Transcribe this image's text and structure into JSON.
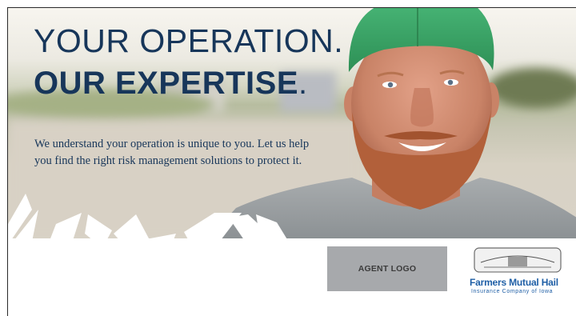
{
  "headline": {
    "line1": "YOUR OPERATION.",
    "line2": "OUR EXPERTISE",
    "line2_period": "."
  },
  "body_copy": "We understand your operation is unique to you. Let us help you find the right risk management solutions to protect it.",
  "agent_logo": {
    "label": "AGENT LOGO"
  },
  "company": {
    "seal_text": "HAIL INSURANCE COMPANY",
    "name": "Farmers Mutual Hail",
    "subtitle": "Insurance Company of Iowa"
  },
  "colors": {
    "navy": "#17365a",
    "cap_green": "#3ea86a",
    "shirt_gray": "#9aa0a3",
    "agent_box": "#a7a9ac",
    "brand_blue": "#1f5fa6"
  }
}
